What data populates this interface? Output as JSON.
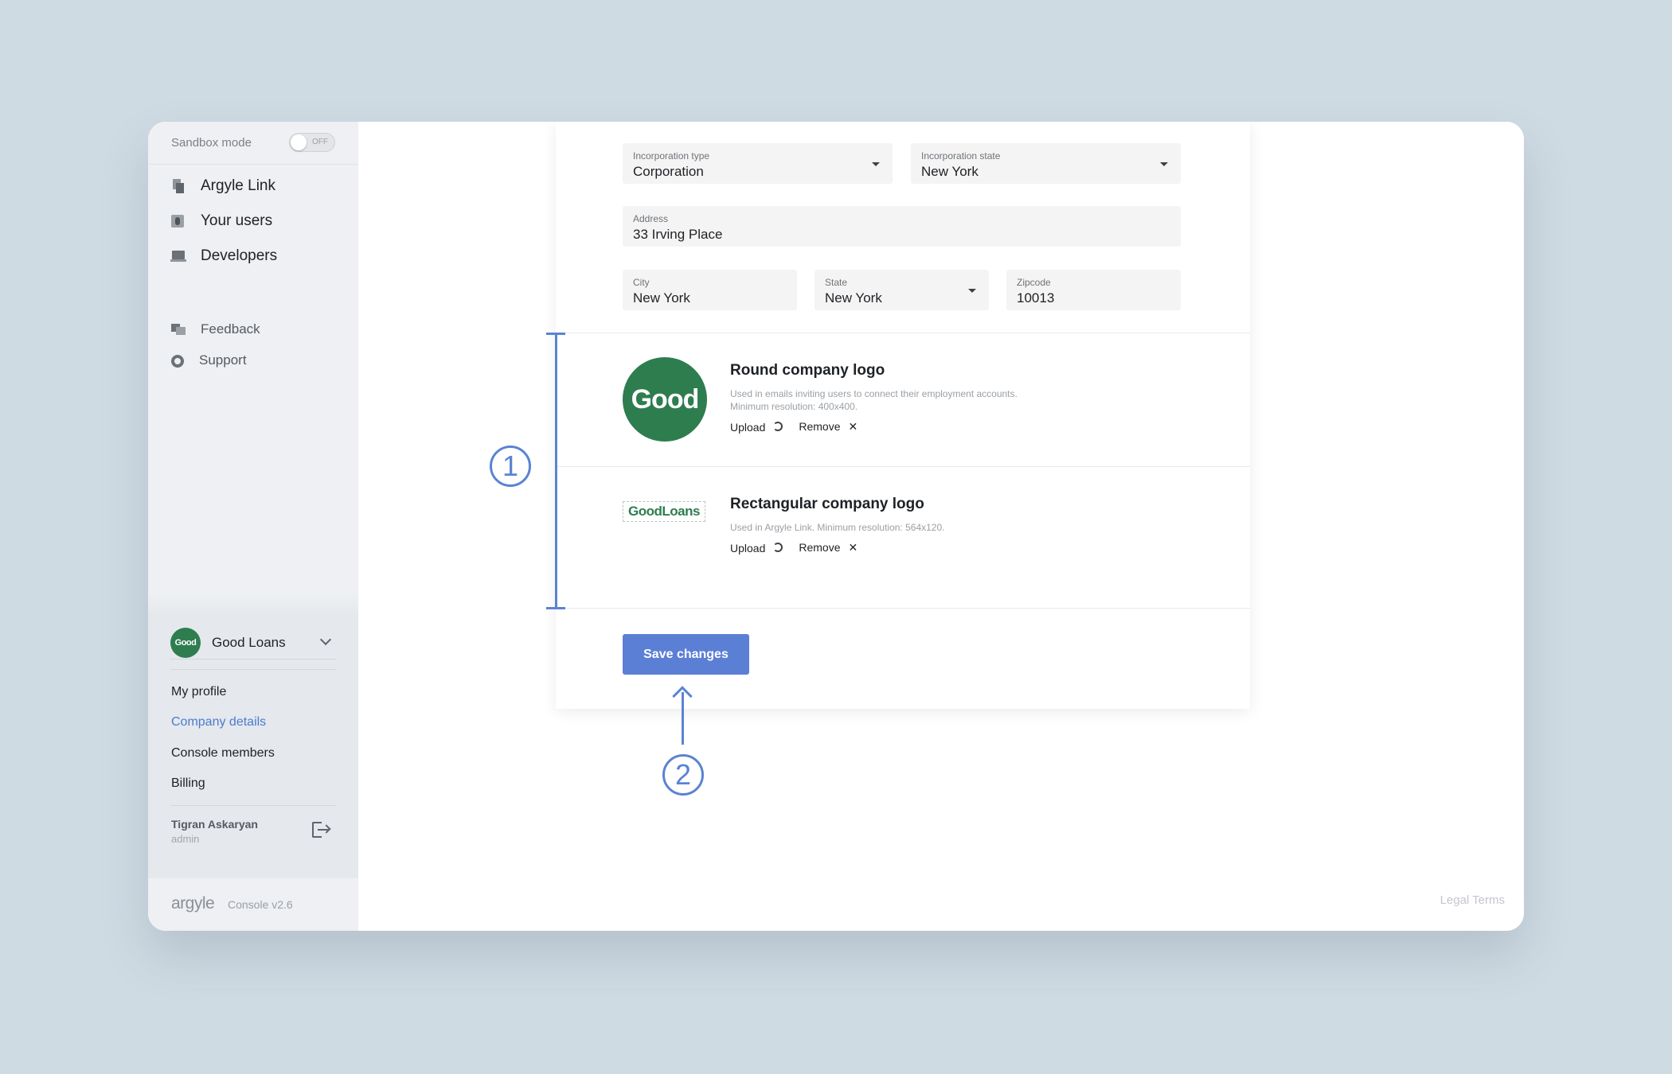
{
  "sidebar": {
    "sandbox": {
      "label": "Sandbox mode",
      "toggle_text": "OFF"
    },
    "nav_primary": [
      {
        "label": "Argyle Link",
        "icon": "link-icon"
      },
      {
        "label": "Your users",
        "icon": "users-icon"
      },
      {
        "label": "Developers",
        "icon": "laptop-icon"
      }
    ],
    "nav_secondary": [
      {
        "label": "Feedback",
        "icon": "feedback-icon"
      },
      {
        "label": "Support",
        "icon": "lifebuoy-icon"
      }
    ],
    "company": {
      "avatar_text": "Good",
      "name": "Good Loans"
    },
    "account_links": [
      {
        "label": "My profile"
      },
      {
        "label": "Company details",
        "active": true
      },
      {
        "label": "Console members"
      },
      {
        "label": "Billing"
      }
    ],
    "user": {
      "name": "Tigran Askaryan",
      "role": "admin"
    },
    "footer": {
      "brand": "argyle",
      "version": "Console v2.6"
    }
  },
  "form": {
    "incorporation_type": {
      "label": "Incorporation type",
      "value": "Corporation"
    },
    "incorporation_state": {
      "label": "Incorporation state",
      "value": "New York"
    },
    "address": {
      "label": "Address",
      "value": "33 Irving Place"
    },
    "city": {
      "label": "City",
      "value": "New York"
    },
    "state": {
      "label": "State",
      "value": "New York"
    },
    "zipcode": {
      "label": "Zipcode",
      "value": "10013"
    }
  },
  "logos": {
    "round": {
      "image_text": "Good",
      "title": "Round company logo",
      "desc_line1": "Used in emails inviting users to connect their employment accounts.",
      "desc_line2": "Minimum resolution: 400x400.",
      "upload_label": "Upload",
      "remove_label": "Remove"
    },
    "rect": {
      "image_text": "GoodLoans",
      "title": "Rectangular company logo",
      "desc_line1": "Used in Argyle Link. Minimum resolution: 564x120.",
      "upload_label": "Upload",
      "remove_label": "Remove"
    }
  },
  "actions": {
    "save_label": "Save changes"
  },
  "footer": {
    "legal": "Legal Terms"
  },
  "annotations": {
    "one": "1",
    "two": "2"
  },
  "colors": {
    "background": "#cfdbe3",
    "accent": "#5c7fd6",
    "annotation": "#5a83d3",
    "brand_green": "#2e7d4f",
    "active_link": "#4a7bd0"
  }
}
